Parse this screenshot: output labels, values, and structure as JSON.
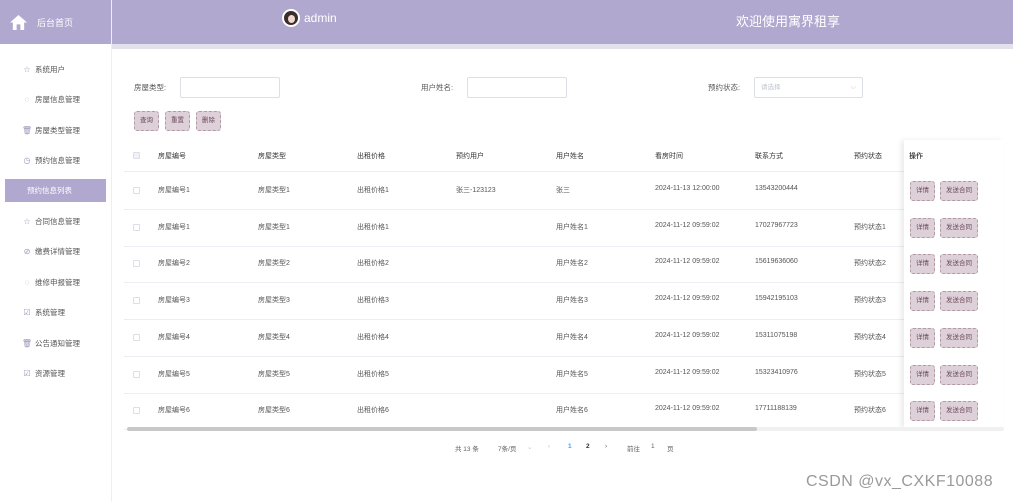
{
  "sidebar": {
    "brand": "后台首页",
    "items": [
      {
        "label": "系统用户",
        "icon": "star-icon"
      },
      {
        "label": "房屋信息管理",
        "icon": "circle-icon"
      },
      {
        "label": "房屋类型管理",
        "icon": "trash-icon"
      },
      {
        "label": "预约信息管理",
        "icon": "clock-icon"
      },
      {
        "label": "预约信息列表",
        "icon": "",
        "active": true
      },
      {
        "label": "合同信息管理",
        "icon": "star-icon"
      },
      {
        "label": "缴费详情管理",
        "icon": "timer-icon"
      },
      {
        "label": "维修申报管理",
        "icon": "circle-icon"
      },
      {
        "label": "系统管理",
        "icon": "checkbox-icon"
      },
      {
        "label": "公告通知管理",
        "icon": "trash-icon"
      },
      {
        "label": "资源管理",
        "icon": "checkbox-icon"
      }
    ]
  },
  "topbar": {
    "user": "admin",
    "welcome": "欢迎使用寓界租享"
  },
  "search": {
    "house_type_label": "房屋类型:",
    "house_type_value": "",
    "user_name_label": "用户姓名:",
    "user_name_value": "",
    "status_label": "预约状态:",
    "status_placeholder": "请选择"
  },
  "buttons": {
    "query": "查询",
    "reset": "重置",
    "delete": "删除"
  },
  "table": {
    "headers": [
      "房屋编号",
      "房屋类型",
      "出租价格",
      "预约用户",
      "用户姓名",
      "看房时间",
      "联系方式",
      "预约状态",
      "操作"
    ],
    "rows": [
      [
        "房屋编号1",
        "房屋类型1",
        "出租价格1",
        "张三-123123",
        "张三",
        "2024-11-13 12:00:00",
        "13543200444",
        ""
      ],
      [
        "房屋编号1",
        "房屋类型1",
        "出租价格1",
        "",
        "用户姓名1",
        "2024-11-12 09:59:02",
        "17027967723",
        "预约状态1"
      ],
      [
        "房屋编号2",
        "房屋类型2",
        "出租价格2",
        "",
        "用户姓名2",
        "2024-11-12 09:59:02",
        "15619636060",
        "预约状态2"
      ],
      [
        "房屋编号3",
        "房屋类型3",
        "出租价格3",
        "",
        "用户姓名3",
        "2024-11-12 09:59:02",
        "15942195103",
        "预约状态3"
      ],
      [
        "房屋编号4",
        "房屋类型4",
        "出租价格4",
        "",
        "用户姓名4",
        "2024-11-12 09:59:02",
        "15311075198",
        "预约状态4"
      ],
      [
        "房屋编号5",
        "房屋类型5",
        "出租价格5",
        "",
        "用户姓名5",
        "2024-11-12 09:59:02",
        "15323410976",
        "预约状态5"
      ],
      [
        "房屋编号6",
        "房屋类型6",
        "出租价格6",
        "",
        "用户姓名6",
        "2024-11-12 09:59:02",
        "17711188139",
        "预约状态6"
      ]
    ],
    "detail_label": "详情",
    "contract_label": "发送合同"
  },
  "pagination": {
    "total": "共 13 条",
    "page_size": "7条/页",
    "page1": "1",
    "page2": "2",
    "goto_label": "前往",
    "goto_value": "1",
    "page_suffix": "页"
  },
  "watermark": "CSDN @vx_CXKF10088",
  "colors": {
    "accent": "#b0a8cf",
    "button_bg": "#ddd0d8",
    "button_border": "#b29aa6"
  }
}
